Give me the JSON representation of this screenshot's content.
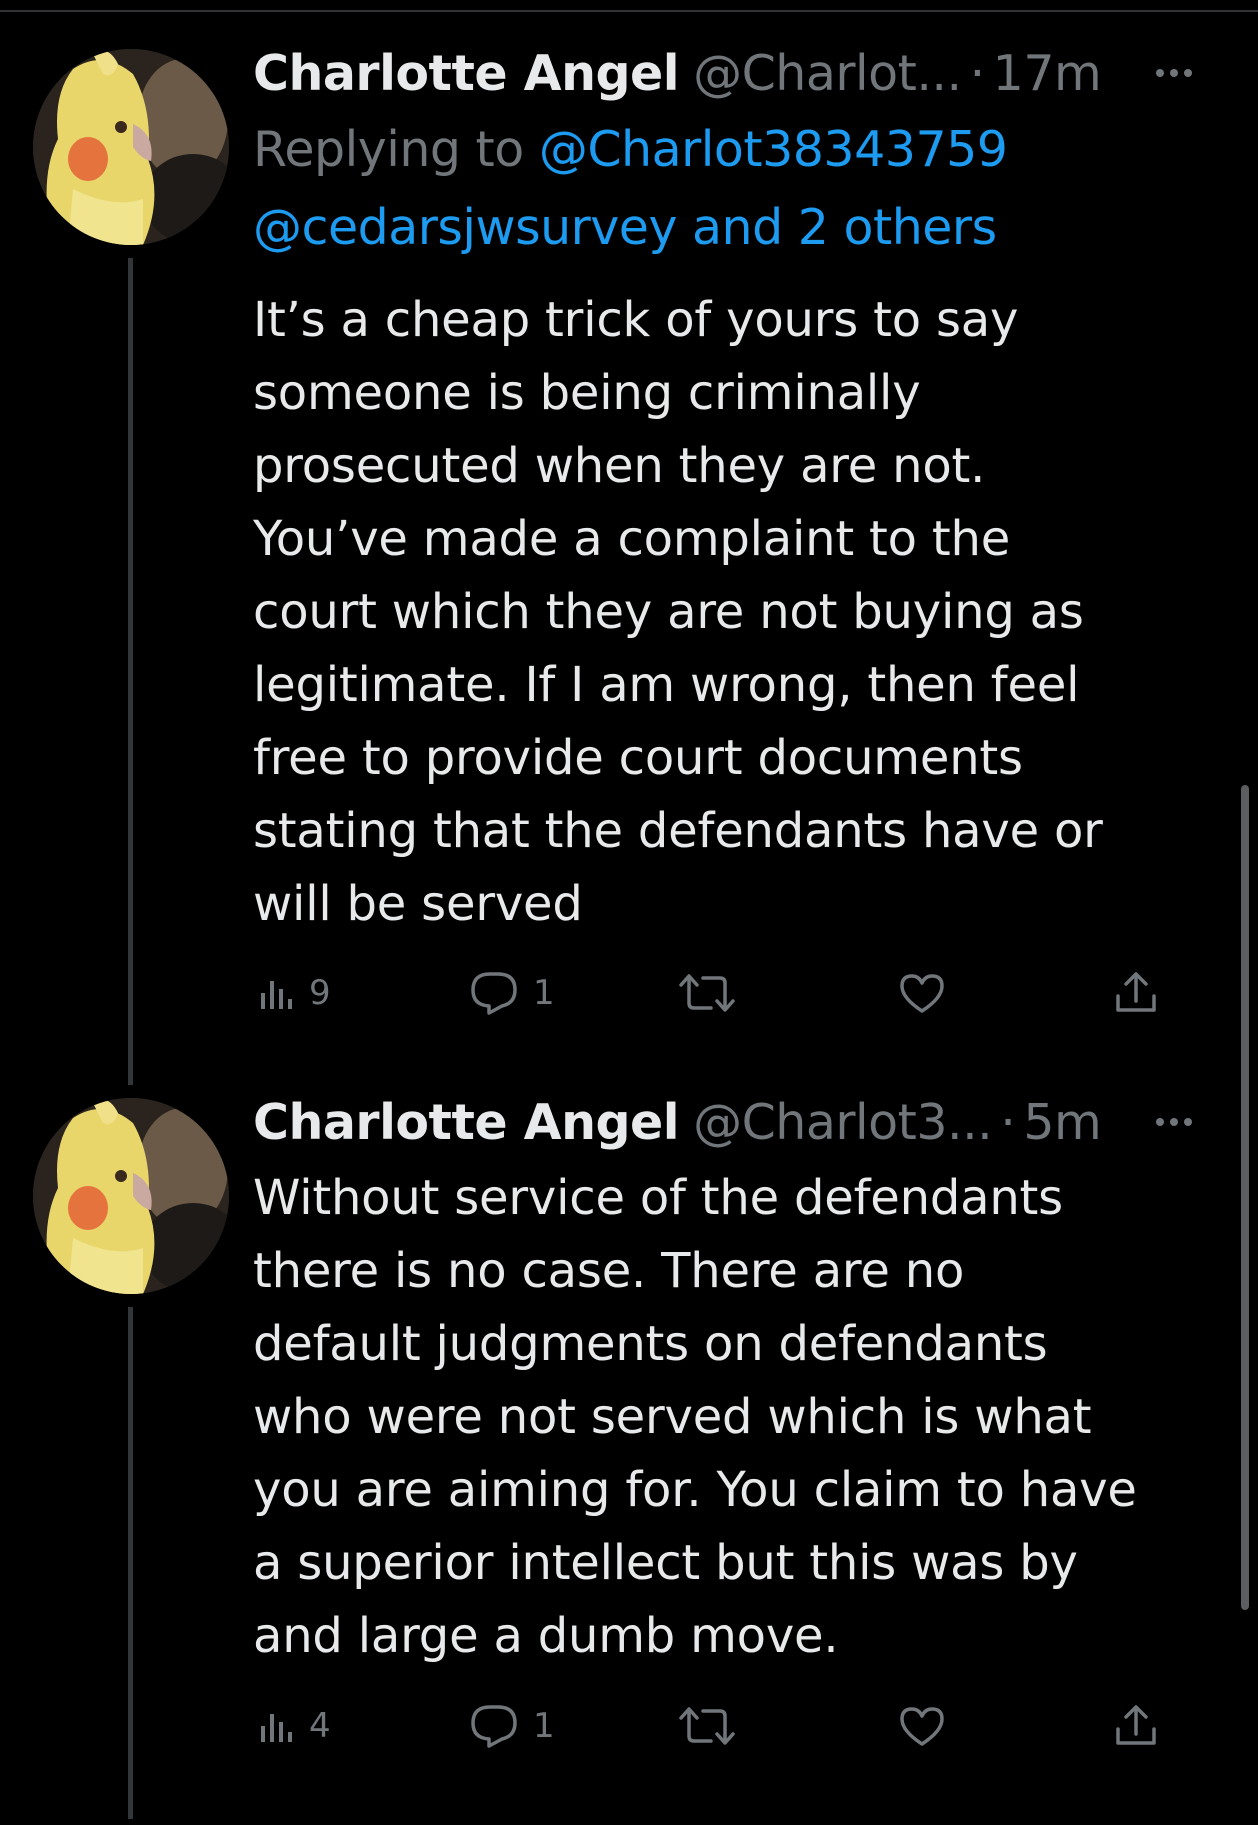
{
  "tweets": [
    {
      "name": "Charlotte Angel",
      "handle": "@Charlot...",
      "time": "17m",
      "replying_to_prefix": "Replying to",
      "replying_to_mention": "@Charlot38343759",
      "replying_to_others": "@cedarsjwsurvey and 2 others",
      "text": "It’s a cheap trick of yours to say\nsomeone is being criminally\nprosecuted when they are not.\nYou’ve made a complaint to the\ncourt which they are not buying as\nlegitimate.  If I am wrong, then feel\nfree to provide court documents\nstating that the defendants have or\nwill be served",
      "views": "9",
      "replies": "1"
    },
    {
      "name": "Charlotte Angel",
      "handle": "@Charlot3...",
      "time": "5m",
      "text": "Without service of the defendants\nthere is no case.  There are no\ndefault judgments on defendants\nwho were not served which is what\nyou are aiming for. You claim to have\na superior intellect but this was by\nand large a dumb move.",
      "views": "4",
      "replies": "1"
    }
  ],
  "separator": "·",
  "icons": {
    "more": "more-horizontal-icon",
    "views": "analytics-bar-chart-icon",
    "reply": "speech-bubble-icon",
    "retweet": "retweet-arrows-icon",
    "like": "heart-icon",
    "share": "share-upload-icon"
  },
  "colors": {
    "background": "#000000",
    "text": "#e7e9ea",
    "secondary": "#71767b",
    "link": "#1d9bf0",
    "thread_line": "#333639"
  }
}
